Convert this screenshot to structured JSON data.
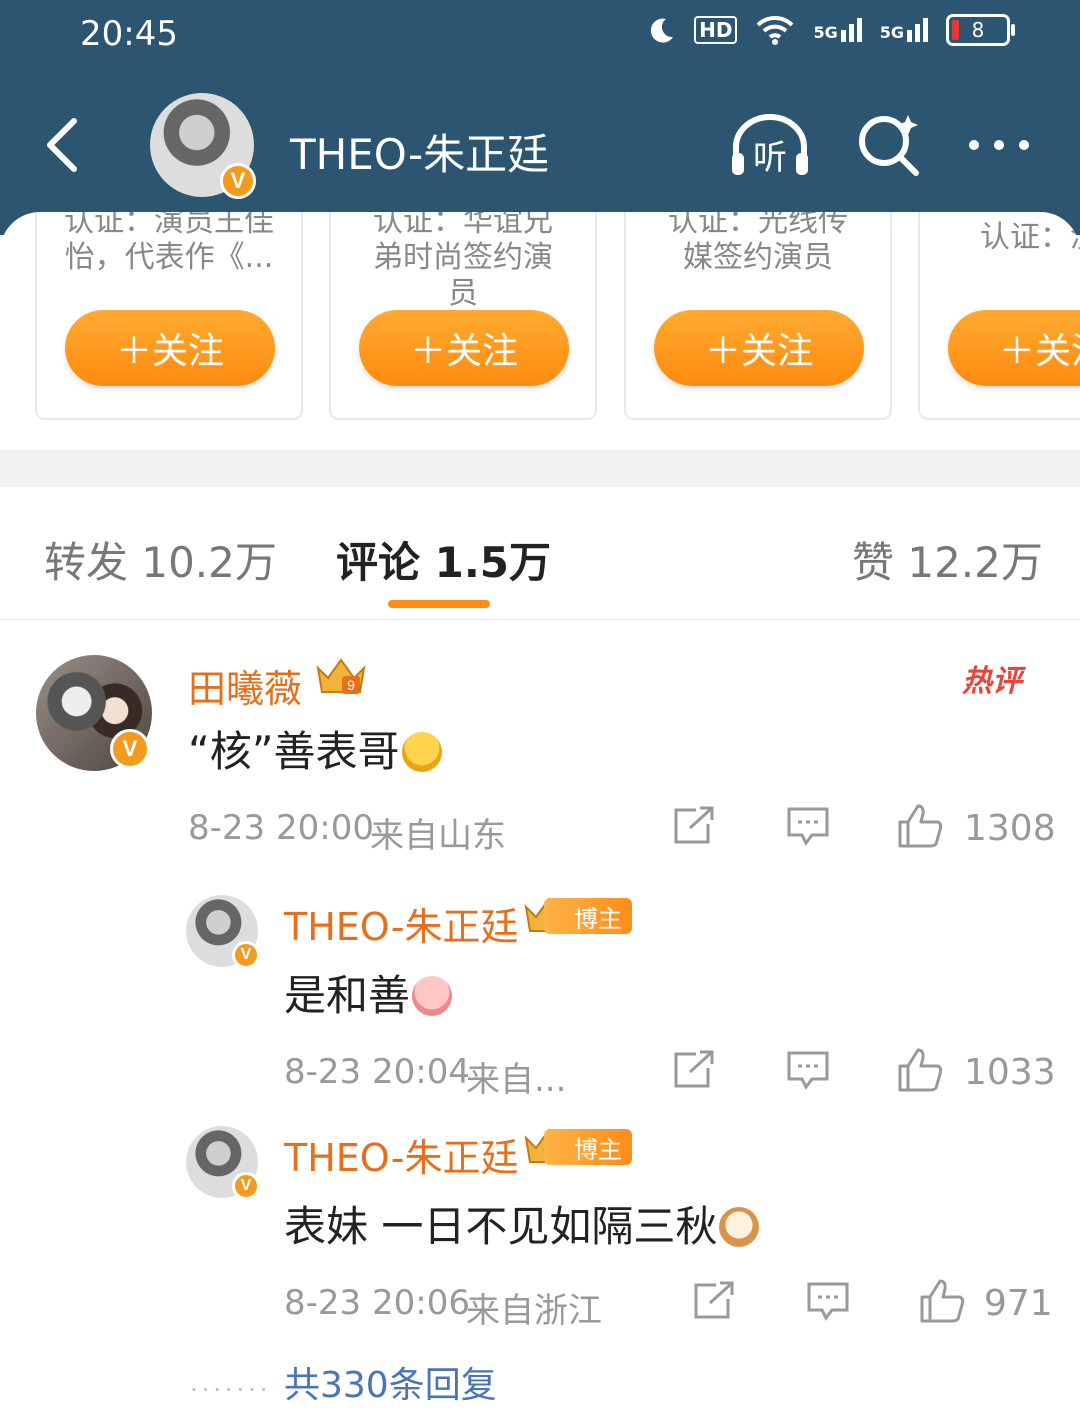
{
  "status_bar": {
    "time": "20:45",
    "hd": "HD",
    "net1": "5G",
    "net2": "5G",
    "battery": "8"
  },
  "header": {
    "title": "THEO-朱正廷"
  },
  "recommend_cards": [
    {
      "desc": "认证：演员王佳怡，代表作《...",
      "follow_label": "＋关注"
    },
    {
      "desc": "认证：华谊兄弟时尚签约演员",
      "follow_label": "＋关注"
    },
    {
      "desc": "认证：光线传媒签约演员",
      "follow_label": "＋关注"
    },
    {
      "desc": "认证：演",
      "follow_label": "＋关注"
    }
  ],
  "tabs": {
    "repost": "转发 10.2万",
    "comments": "评论 1.5万",
    "likes": "赞 12.2万"
  },
  "comments": [
    {
      "name": "田曦薇",
      "text": "“核”善表哥",
      "time": "8-23 20:00",
      "source": "来自山东",
      "likes": "1308",
      "hot": "热评"
    }
  ],
  "replies": [
    {
      "name": "THEO-朱正廷",
      "badge": "博主",
      "text": "是和善",
      "time": "8-23 20:04",
      "source": "来自...",
      "likes": "1033"
    },
    {
      "name": "THEO-朱正廷",
      "badge": "博主",
      "text": "表妹 一日不见如隔三秋",
      "time": "8-23 20:06",
      "source": "来自浙江",
      "likes": "971"
    }
  ],
  "total_replies": "共330条回复",
  "colors": {
    "header_bg": "#2b5570",
    "accent": "#ff8c14",
    "name": "#e66f1c",
    "link": "#4a73b8"
  }
}
